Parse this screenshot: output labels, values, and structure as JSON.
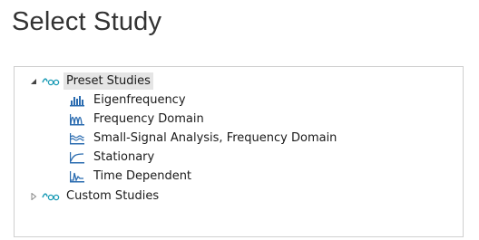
{
  "page_title": "Select Study",
  "tree": {
    "preset": {
      "label": "Preset Studies",
      "expanded": true,
      "selected": true,
      "icon": "study-group-icon",
      "children": [
        {
          "label": "Eigenfrequency",
          "icon": "eigenfrequency-icon"
        },
        {
          "label": "Frequency Domain",
          "icon": "frequency-domain-icon"
        },
        {
          "label": "Small-Signal Analysis, Frequency Domain",
          "icon": "small-signal-icon"
        },
        {
          "label": "Stationary",
          "icon": "stationary-icon"
        },
        {
          "label": "Time Dependent",
          "icon": "time-dependent-icon"
        }
      ]
    },
    "custom": {
      "label": "Custom Studies",
      "expanded": false,
      "icon": "study-group-icon"
    }
  },
  "colors": {
    "icon_blue": "#2b6cb0",
    "icon_teal": "#1a9bb5",
    "selection": "#e5e5e5",
    "border": "#cfcfcf"
  }
}
